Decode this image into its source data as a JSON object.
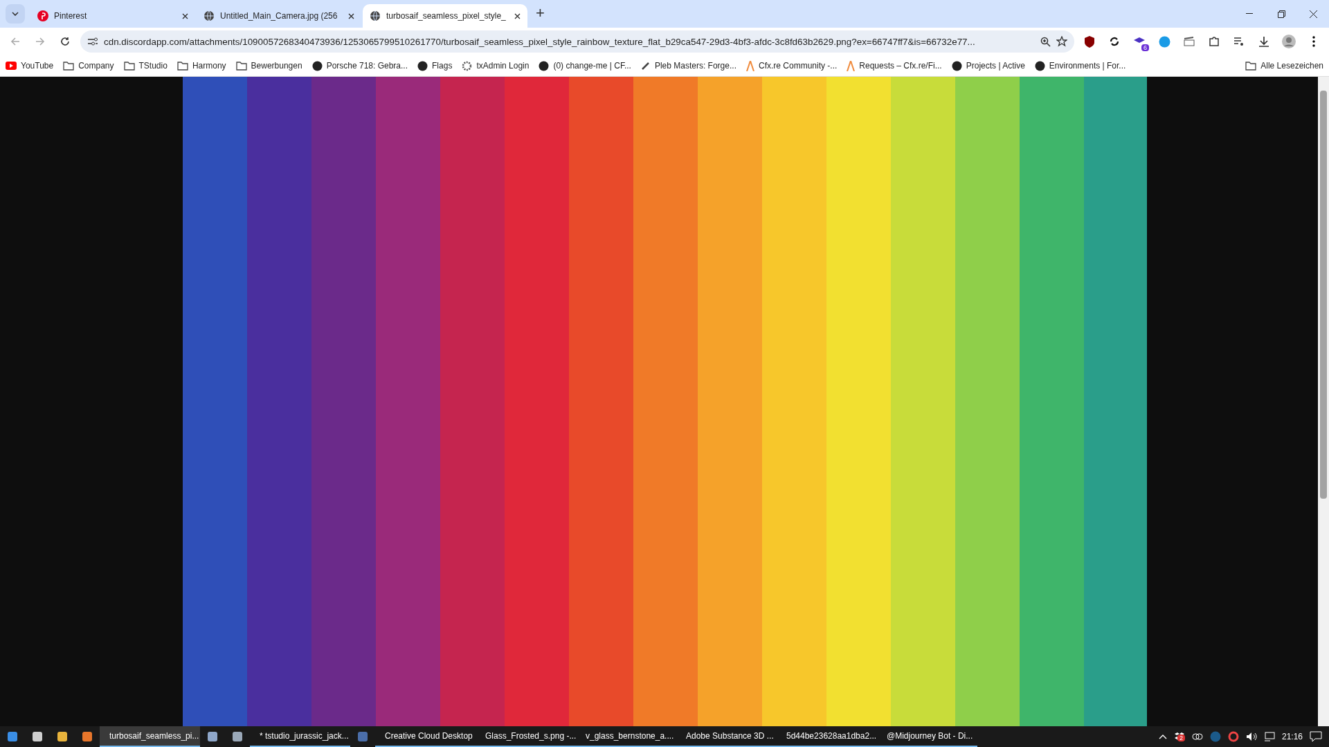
{
  "tabs": [
    {
      "label": "Pinterest",
      "kind": "pinterest",
      "selected": false
    },
    {
      "label": "Untitled_Main_Camera.jpg (256",
      "kind": "globe",
      "selected": false
    },
    {
      "label": "turbosaif_seamless_pixel_style_",
      "kind": "globe",
      "selected": true
    }
  ],
  "new_tab": "+",
  "address": {
    "value": "cdn.discordapp.com/attachments/1090057268340473936/1253065799510261770/turbosaif_seamless_pixel_style_rainbow_texture_flat_b29ca547-29d3-4bf3-afdc-3c8fd63b2629.png?ex=66747ff7&is=66732e77..."
  },
  "extension_badge": "6",
  "bookmarks": [
    {
      "label": "YouTube",
      "kind": "youtube"
    },
    {
      "label": "Company",
      "kind": "folder"
    },
    {
      "label": "TStudio",
      "kind": "folder"
    },
    {
      "label": "Harmony",
      "kind": "folder"
    },
    {
      "label": "Bewerbungen",
      "kind": "folder"
    },
    {
      "label": "Porsche 718: Gebra...",
      "kind": "site"
    },
    {
      "label": "Flags",
      "kind": "site"
    },
    {
      "label": "txAdmin Login",
      "kind": "gear"
    },
    {
      "label": "(0) change-me | CF...",
      "kind": "site"
    },
    {
      "label": "Pleb Masters: Forge...",
      "kind": "brush"
    },
    {
      "label": "Cfx.re Community -...",
      "kind": "cfx"
    },
    {
      "label": "Requests – Cfx.re/Fi...",
      "kind": "cfx"
    },
    {
      "label": "Projects | Active",
      "kind": "site"
    },
    {
      "label": "Environments | For...",
      "kind": "site"
    }
  ],
  "all_bookmarks": "Alle Lesezeichen",
  "taskbar": [
    {
      "kind": "pinned"
    },
    {
      "kind": "pinned"
    },
    {
      "kind": "pinned"
    },
    {
      "kind": "pinned"
    },
    {
      "kind": "app",
      "label": "turbosaif_seamless_pi...",
      "selected": true
    },
    {
      "kind": "pinned"
    },
    {
      "kind": "pinned"
    },
    {
      "kind": "app",
      "label": "* tstudio_jurassic_jack...",
      "selected": false
    },
    {
      "kind": "pinned"
    },
    {
      "kind": "app",
      "label": "Creative Cloud Desktop",
      "selected": false
    },
    {
      "kind": "app",
      "label": "Glass_Frosted_s.png -...",
      "selected": false
    },
    {
      "kind": "app",
      "label": "v_glass_bernstone_a....",
      "selected": false
    },
    {
      "kind": "app",
      "label": "Adobe Substance 3D ...",
      "selected": false
    },
    {
      "kind": "app",
      "label": "5d44be23628aa1dba2...",
      "selected": false
    },
    {
      "kind": "app",
      "label": "@Midjourney Bot - Di...",
      "selected": false
    }
  ],
  "tray": {
    "badge": "2",
    "time": "21:16"
  }
}
